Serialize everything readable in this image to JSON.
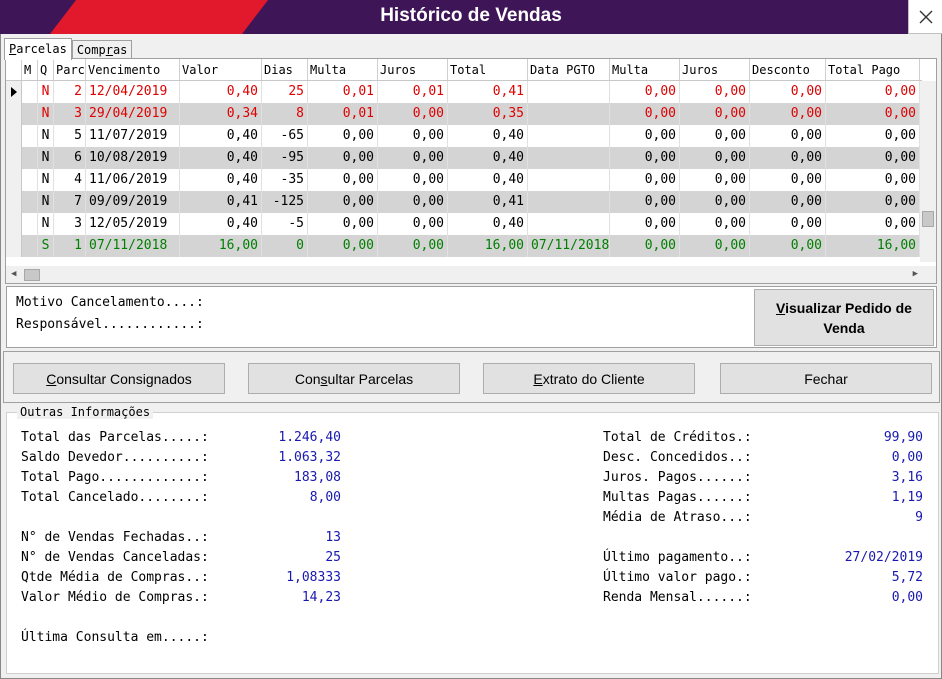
{
  "window": {
    "title": "Histórico de Vendas",
    "accent_color": "#e2182c",
    "title_bg": "#3e1657"
  },
  "tabs": [
    {
      "label": "Parcelas",
      "underline": "P",
      "rest": "arcelas",
      "active": true
    },
    {
      "label": "Compras",
      "pre": "Comp",
      "underline": "r",
      "rest": "as",
      "active": false
    }
  ],
  "grid": {
    "columns": [
      "M",
      "Q",
      "Parc",
      "Vencimento",
      "Valor",
      "Dias",
      "Multa",
      "Juros",
      "Total",
      "Data PGTO",
      "Multa",
      "Juros",
      "Desconto",
      "Total Pago"
    ],
    "rows": [
      {
        "color": "red",
        "current": true,
        "cells": [
          "",
          "N",
          "2",
          "12/04/2019",
          "0,40",
          "25",
          "0,01",
          "0,01",
          "0,41",
          "",
          "0,00",
          "0,00",
          "0,00",
          "0,00"
        ]
      },
      {
        "color": "red",
        "current": false,
        "cells": [
          "",
          "N",
          "3",
          "29/04/2019",
          "0,34",
          "8",
          "0,01",
          "0,00",
          "0,35",
          "",
          "0,00",
          "0,00",
          "0,00",
          "0,00"
        ]
      },
      {
        "color": "black",
        "current": false,
        "cells": [
          "",
          "N",
          "5",
          "11/07/2019",
          "0,40",
          "-65",
          "0,00",
          "0,00",
          "0,40",
          "",
          "0,00",
          "0,00",
          "0,00",
          "0,00"
        ]
      },
      {
        "color": "black",
        "current": false,
        "cells": [
          "",
          "N",
          "6",
          "10/08/2019",
          "0,40",
          "-95",
          "0,00",
          "0,00",
          "0,40",
          "",
          "0,00",
          "0,00",
          "0,00",
          "0,00"
        ]
      },
      {
        "color": "black",
        "current": false,
        "cells": [
          "",
          "N",
          "4",
          "11/06/2019",
          "0,40",
          "-35",
          "0,00",
          "0,00",
          "0,40",
          "",
          "0,00",
          "0,00",
          "0,00",
          "0,00"
        ]
      },
      {
        "color": "black",
        "current": false,
        "cells": [
          "",
          "N",
          "7",
          "09/09/2019",
          "0,41",
          "-125",
          "0,00",
          "0,00",
          "0,41",
          "",
          "0,00",
          "0,00",
          "0,00",
          "0,00"
        ]
      },
      {
        "color": "black",
        "current": false,
        "cells": [
          "",
          "N",
          "3",
          "12/05/2019",
          "0,40",
          "-5",
          "0,00",
          "0,00",
          "0,40",
          "",
          "0,00",
          "0,00",
          "0,00",
          "0,00"
        ]
      },
      {
        "color": "green",
        "current": false,
        "cells": [
          "",
          "S",
          "1",
          "07/11/2018",
          "16,00",
          "0",
          "0,00",
          "0,00",
          "16,00",
          "07/11/2018",
          "0,00",
          "0,00",
          "0,00",
          "16,00"
        ]
      }
    ]
  },
  "cancel": {
    "motivo_label": "Motivo Cancelamento....:",
    "responsavel_label": "Responsável............:",
    "view_order_button_u": "V",
    "view_order_button_rest": "isualizar Pedido de Venda"
  },
  "buttons": {
    "consignados_u": "C",
    "consignados_rest": "onsultar Consignados",
    "parcelas_pre": "Con",
    "parcelas_u": "s",
    "parcelas_rest": "ultar Parcelas",
    "extrato_u": "E",
    "extrato_rest": "xtrato do Cliente",
    "fechar_label": "Fechar"
  },
  "info": {
    "legend": "Outras Informações",
    "left": [
      {
        "label": "Total das Parcelas.....:",
        "value": "1.246,40"
      },
      {
        "label": "Saldo Devedor..........:",
        "value": "1.063,32"
      },
      {
        "label": "Total Pago.............:",
        "value": "183,08"
      },
      {
        "label": "Total Cancelado........:",
        "value": "8,00"
      },
      {
        "label": "",
        "value": ""
      },
      {
        "label": "N° de Vendas Fechadas..:",
        "value": "13"
      },
      {
        "label": "N° de Vendas Canceladas:",
        "value": "25"
      },
      {
        "label": "Qtde Média de Compras..:",
        "value": "1,08333"
      },
      {
        "label": "Valor Médio de Compras.:",
        "value": "14,23"
      },
      {
        "label": "",
        "value": ""
      },
      {
        "label": "Última Consulta em.....:",
        "value": ""
      }
    ],
    "right": [
      {
        "label": "Total de Créditos.:",
        "value": "99,90"
      },
      {
        "label": "Desc. Concedidos..:",
        "value": "0,00"
      },
      {
        "label": "Juros. Pagos......:",
        "value": "3,16"
      },
      {
        "label": "Multas Pagas......:",
        "value": "1,19"
      },
      {
        "label": "Média de Atraso...:",
        "value": "9"
      },
      {
        "label": "Último pagamento..:",
        "value": "27/02/2019"
      },
      {
        "label": "Último valor pago.:",
        "value": "5,72"
      },
      {
        "label": "Renda Mensal......:",
        "value": "0,00"
      }
    ]
  }
}
